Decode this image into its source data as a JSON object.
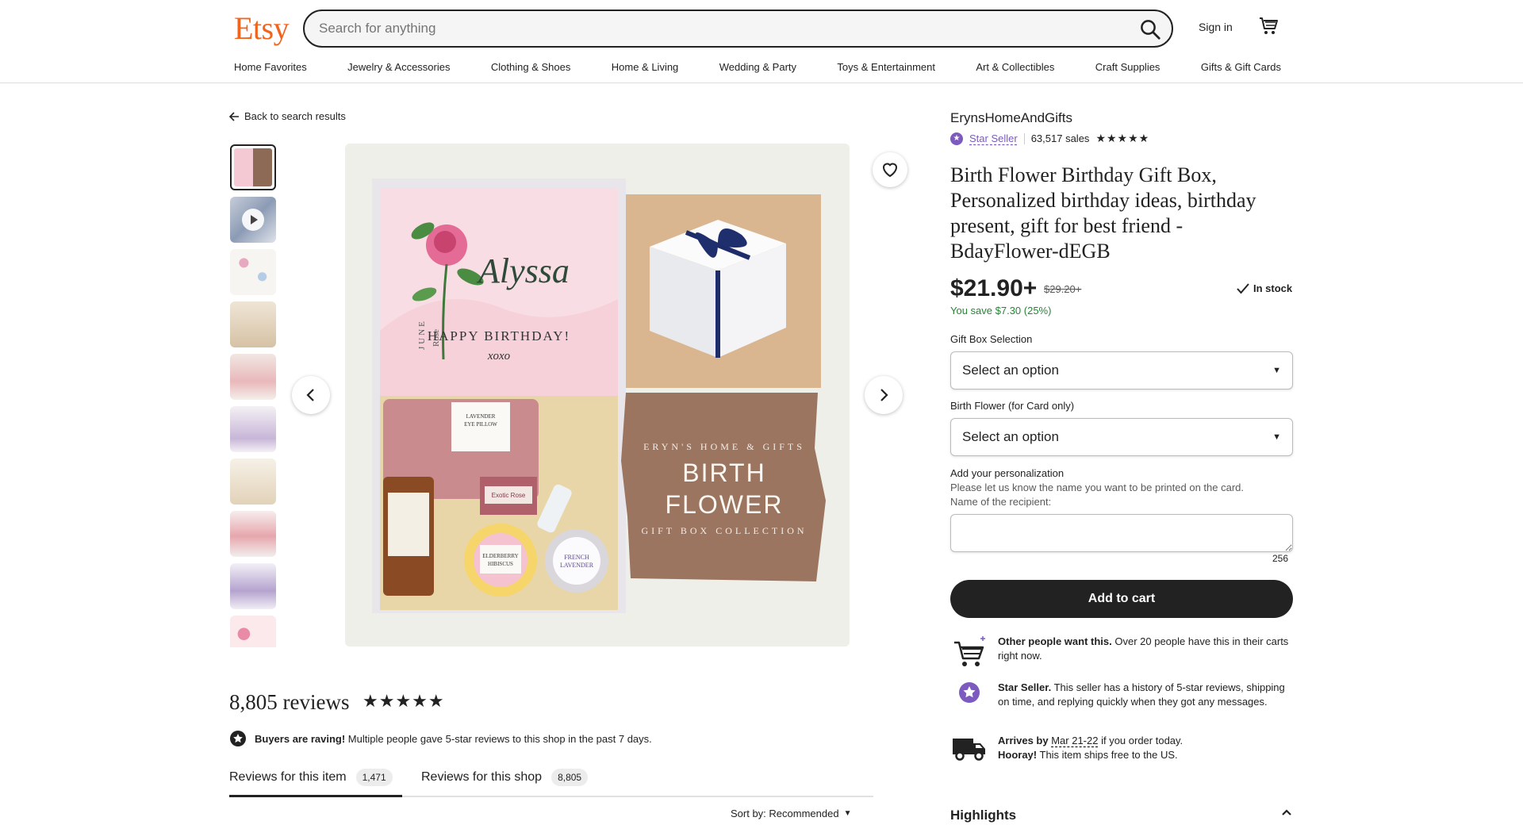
{
  "header": {
    "logo": "Etsy",
    "search_placeholder": "Search for anything",
    "sign_in": "Sign in"
  },
  "nav": [
    "Home Favorites",
    "Jewelry & Accessories",
    "Clothing & Shoes",
    "Home & Living",
    "Wedding & Party",
    "Toys & Entertainment",
    "Art & Collectibles",
    "Craft Supplies",
    "Gifts & Gift Cards"
  ],
  "back_link": "Back to search results",
  "image": {
    "card_name": "Alyssa",
    "card_month": "JUNE",
    "card_flower": "Rose",
    "card_greeting": "HAPPY BIRTHDAY!",
    "card_xoxo": "xoxo",
    "pillow_label_1": "LAVENDER",
    "pillow_label_2": "EYE PILLOW",
    "soap_label": "Exotic Rose",
    "tea_label_1": "ELDERBERRY",
    "tea_label_2": "HIBISCUS",
    "candle_label_1": "FRENCH",
    "candle_label_2": "LAVENDER",
    "brand_line": "ERYN'S HOME & GIFTS",
    "headline_1": "BIRTH",
    "headline_2": "FLOWER",
    "collection_line": "GIFT BOX COLLECTION"
  },
  "reviews": {
    "title": "8,805 reviews",
    "stars": "★★★★★",
    "raving_bold": "Buyers are raving!",
    "raving_text": " Multiple people gave 5-star reviews to this shop in the past 7 days.",
    "tab_item": "Reviews for this item",
    "tab_item_count": "1,471",
    "tab_shop": "Reviews for this shop",
    "tab_shop_count": "8,805",
    "sort": "Sort by: Recommended"
  },
  "listing": {
    "shop_name": "ErynsHomeAndGifts",
    "star_seller": "Star Seller",
    "sales": "63,517 sales",
    "stars": "★★★★★",
    "title": "Birth Flower Birthday Gift Box, Personalized birthday ideas, birthday present, gift for best friend - BdayFlower-dEGB",
    "price": "$21.90+",
    "old_price": "$29.20+",
    "stock": "In stock",
    "save": "You save $7.30 (25%)",
    "option1_label": "Gift Box Selection",
    "option1_value": "Select an option",
    "option2_label": "Birth Flower (for Card only)",
    "option2_value": "Select an option",
    "personalization_label": "Add your personalization",
    "personalization_hint_1": "Please let us know the name you want to be printed on the card.",
    "personalization_hint_2": "Name of the recipient:",
    "char_count": "256",
    "add_to_cart": "Add to cart",
    "feature1_bold": "Other people want this.",
    "feature1_text": " Over 20 people have this in their carts right now.",
    "feature2_bold": "Star Seller.",
    "feature2_text": " This seller has a history of 5-star reviews, shipping on time, and replying quickly when they got any messages.",
    "feature3_bold": "Arrives by",
    "feature3_date": "Mar 21-22",
    "feature3_text": " if you order today.",
    "feature3_bold2": "Hooray!",
    "feature3_text2": " This item ships free to the US.",
    "highlights": "Highlights"
  },
  "colors": {
    "brand": "#f1641e",
    "star_seller": "#7d5abf",
    "save_green": "#258635"
  }
}
